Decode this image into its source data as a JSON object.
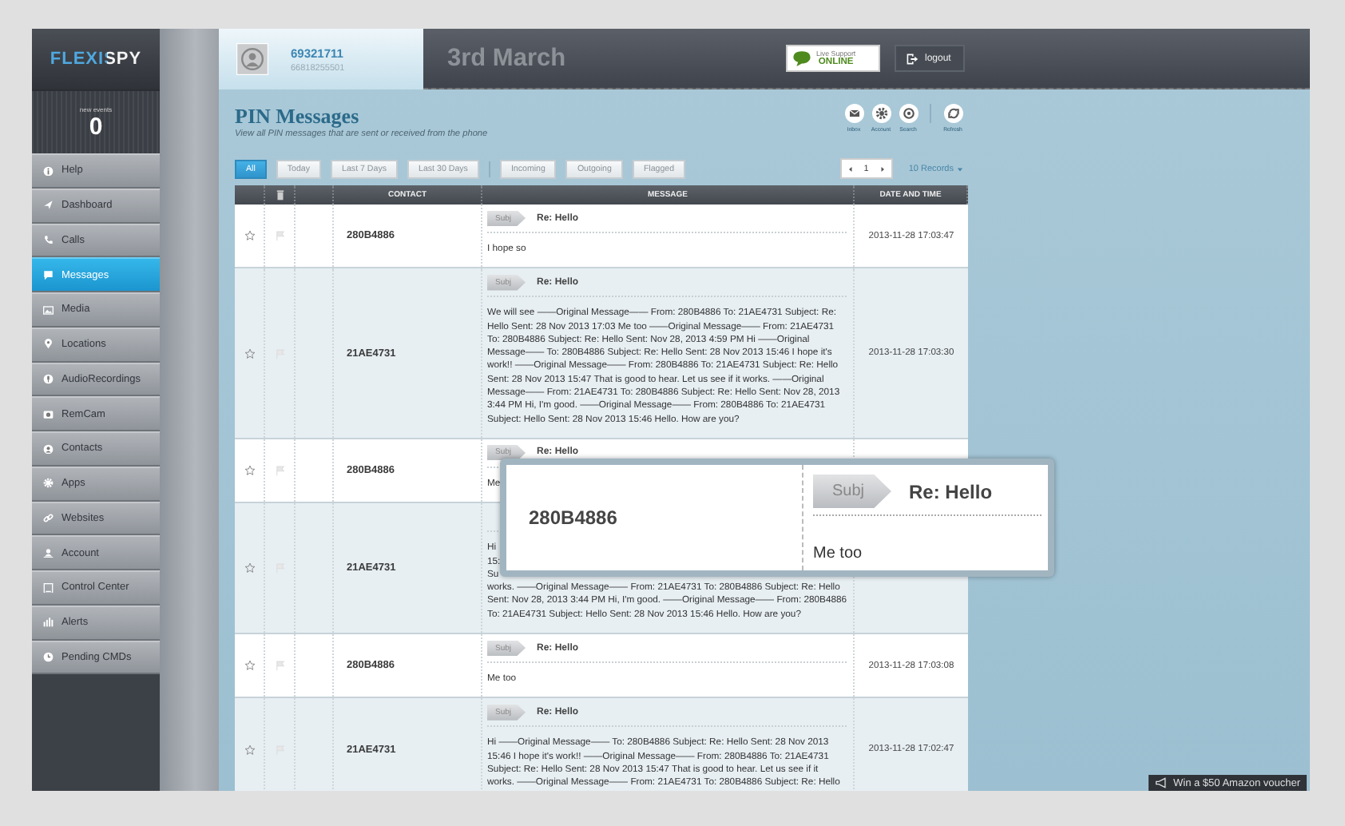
{
  "sidebar": {
    "logo": "FLEXISPY",
    "new_events_label": "new events",
    "new_events_count": "0",
    "items": [
      {
        "label": "Help",
        "selected": false
      },
      {
        "label": "Dashboard",
        "selected": false
      },
      {
        "label": "Calls",
        "selected": false
      },
      {
        "label": "Messages",
        "selected": true
      },
      {
        "label": "Media",
        "selected": false
      },
      {
        "label": "Locations",
        "selected": false
      },
      {
        "label": "AudioRecordings",
        "selected": false
      },
      {
        "label": "RemCam",
        "selected": false
      },
      {
        "label": "Contacts",
        "selected": false
      },
      {
        "label": "Apps",
        "selected": false
      },
      {
        "label": "Websites",
        "selected": false
      },
      {
        "label": "Account",
        "selected": false
      },
      {
        "label": "Control Center",
        "selected": false
      },
      {
        "label": "Alerts",
        "selected": false
      },
      {
        "label": "Pending CMDs",
        "selected": false
      }
    ]
  },
  "header": {
    "device_id": "69321711",
    "phone_number": "66818255501",
    "date": "3rd March",
    "live_support": {
      "label": "Live Support",
      "status": "ONLINE"
    },
    "logout": "logout"
  },
  "page": {
    "title": "PIN Messages",
    "subtitle": "View all PIN messages that are sent or received from the phone"
  },
  "toolbar": [
    {
      "kind": "inbox",
      "label": "Inbox"
    },
    {
      "kind": "account",
      "label": "Account"
    },
    {
      "kind": "search",
      "label": "Search"
    },
    {
      "kind": "refresh",
      "label": "Refresh"
    }
  ],
  "date_filters": [
    {
      "label": "All",
      "selected": true
    },
    {
      "label": "Today",
      "selected": false
    },
    {
      "label": "Last 7 Days",
      "selected": false
    },
    {
      "label": "Last 30 Days",
      "selected": false
    }
  ],
  "type_filters": [
    {
      "label": "Incoming",
      "selected": false
    },
    {
      "label": "Outgoing",
      "selected": false
    },
    {
      "label": "Flagged",
      "selected": false
    }
  ],
  "pager": {
    "page": "1",
    "page_size": "10 Records"
  },
  "table": {
    "columns": [
      "CONTACT",
      "MESSAGE",
      "DATE AND TIME"
    ],
    "rows": [
      {
        "starred": false,
        "flagged": false,
        "contact": "280B4886",
        "subject_tag": "Subj",
        "subject": "Re: Hello",
        "message": "I hope so",
        "datetime": "2013-11-28 17:03:47"
      },
      {
        "starred": false,
        "flagged": false,
        "contact": "21AE4731",
        "subject_tag": "Subj",
        "subject": "Re: Hello",
        "message": "We will see ——Original Message—— From: 280B4886 To: 21AE4731 Subject: Re:\nHello Sent: 28 Nov 2013 17:03 Me too ——Original Message—— From: 21AE4731\nTo: 280B4886 Subject: Re: Hello Sent: Nov 28, 2013 4:59 PM Hi ——Original\nMessage—— To: 280B4886 Subject: Re: Hello Sent: 28 Nov 2013 15:46 I hope it's\nwork!! ——Original Message—— From: 280B4886 To: 21AE4731 Subject: Re: Hello\nSent: 28 Nov 2013 15:47 That is good to hear. Let us see if it works. ——Original\nMessage—— From: 21AE4731 To: 280B4886 Subject: Re: Hello Sent: Nov 28, 2013\n3:44 PM Hi, I'm good. ——Original Message—— From: 280B4886 To: 21AE4731\nSubject: Hello Sent: 28 Nov 2013 15:46 Hello. How are you?",
        "datetime": "2013-11-28 17:03:30"
      },
      {
        "starred": false,
        "flagged": false,
        "contact": "280B4886",
        "subject_tag": "Subj",
        "subject": "Re: Hello",
        "message": "Me"
      },
      {
        "starred": false,
        "flagged": false,
        "contact": "21AE4731",
        "message": [
          "Hi",
          "15:",
          "Su",
          "works. ——Original Message—— From: 21AE4731 To: 280B4886 Subject: Re: Hello\nSent: Nov 28, 2013 3:44 PM Hi, I'm good. ——Original Message—— From: 280B4886\nTo: 21AE4731 Subject: Hello Sent: 28 Nov 2013 15:46 Hello. How are you?"
        ]
      },
      {
        "starred": false,
        "flagged": false,
        "contact": "280B4886",
        "subject_tag": "Subj",
        "subject": "Re: Hello",
        "message": "Me too",
        "datetime": "2013-11-28 17:03:08"
      },
      {
        "starred": false,
        "flagged": false,
        "contact": "21AE4731",
        "subject_tag": "Subj",
        "subject": "Re: Hello",
        "message": "Hi ——Original Message—— To: 280B4886 Subject: Re: Hello Sent: 28 Nov 2013\n15:46 I hope it's work!! ——Original Message—— From: 280B4886 To: 21AE4731\nSubject: Re: Hello Sent: 28 Nov 2013 15:47 That is good to hear. Let us see if it\nworks. ——Original Message—— From: 21AE4731 To: 280B4886 Subject: Re: Hello",
        "datetime": "2013-11-28 17:02:47"
      }
    ]
  },
  "popup": {
    "contact": "280B4886",
    "subject_tag": "Subj",
    "subject": "Re: Hello",
    "message": "Me too"
  },
  "promo": "Win a $50 Amazon voucher"
}
